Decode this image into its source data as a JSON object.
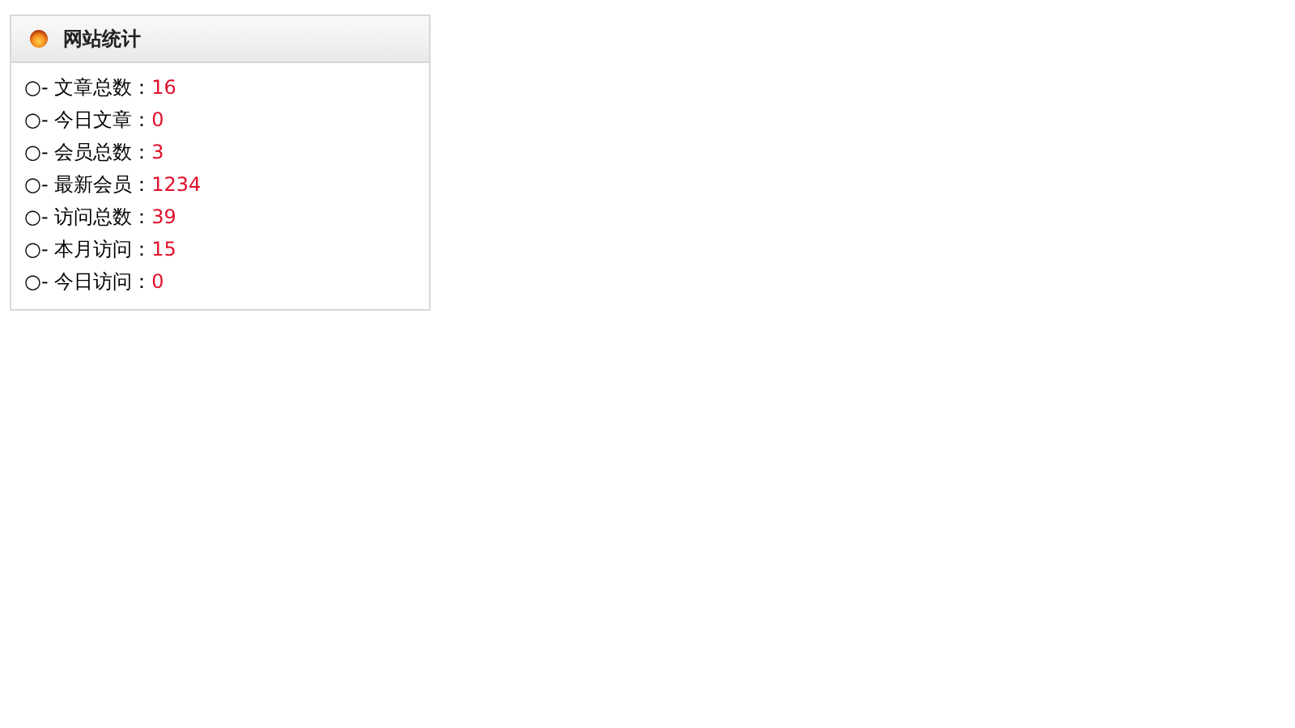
{
  "panel": {
    "title": "网站统计",
    "rows": [
      {
        "label": "○- 文章总数：",
        "value": "16"
      },
      {
        "label": "○- 今日文章：",
        "value": "0"
      },
      {
        "label": "○- 会员总数：",
        "value": "3"
      },
      {
        "label": "○- 最新会员：",
        "value": "1234"
      },
      {
        "label": "○- 访问总数：",
        "value": "39"
      },
      {
        "label": "○- 本月访问：",
        "value": "15"
      },
      {
        "label": "○- 今日访问：",
        "value": "0"
      }
    ]
  }
}
